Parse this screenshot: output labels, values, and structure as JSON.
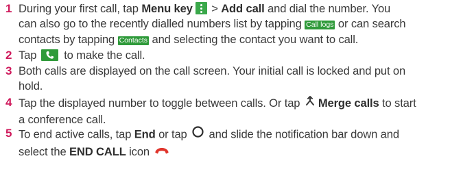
{
  "steps": [
    {
      "number": "1",
      "lines": {
        "l1a": "During your first call, tap ",
        "l1b": "Menu key",
        "l1c": " > ",
        "l1d": "Add call",
        "l1e": " and dial the number. You",
        "l2a": "can also go to the recently dialled numbers list by tapping ",
        "chip1": "Call logs",
        "l2b": " or can search",
        "l3a": "contacts by tapping ",
        "chip2": "Contacts",
        "l3b": " and selecting the contact you want to call."
      }
    },
    {
      "number": "2",
      "lines": {
        "a": "Tap ",
        "b": " to make the call."
      }
    },
    {
      "number": "3",
      "lines": {
        "l1": "Both calls are displayed on the call screen. Your initial call is locked and put on",
        "l2": "hold."
      }
    },
    {
      "number": "4",
      "lines": {
        "l1a": "Tap the displayed number to toggle between calls. Or tap ",
        "l1b": "Merge calls",
        "l1c": " to start",
        "l2": "a conference call."
      }
    },
    {
      "number": "5",
      "lines": {
        "l1a": "To end active calls, tap ",
        "l1b": "End",
        "l1c": " or tap ",
        "l1d": " and slide the notification bar down and",
        "l2a": "select the ",
        "l2b": "END CALL",
        "l2c": " icon "
      }
    }
  ],
  "colors": {
    "number": "#cf1a5c",
    "chip": "#2f9a3a",
    "end_call": "#e0342b"
  },
  "icons": [
    "menu-key-icon",
    "call-icon",
    "merge-calls-icon",
    "home-circle-icon",
    "end-call-icon"
  ]
}
